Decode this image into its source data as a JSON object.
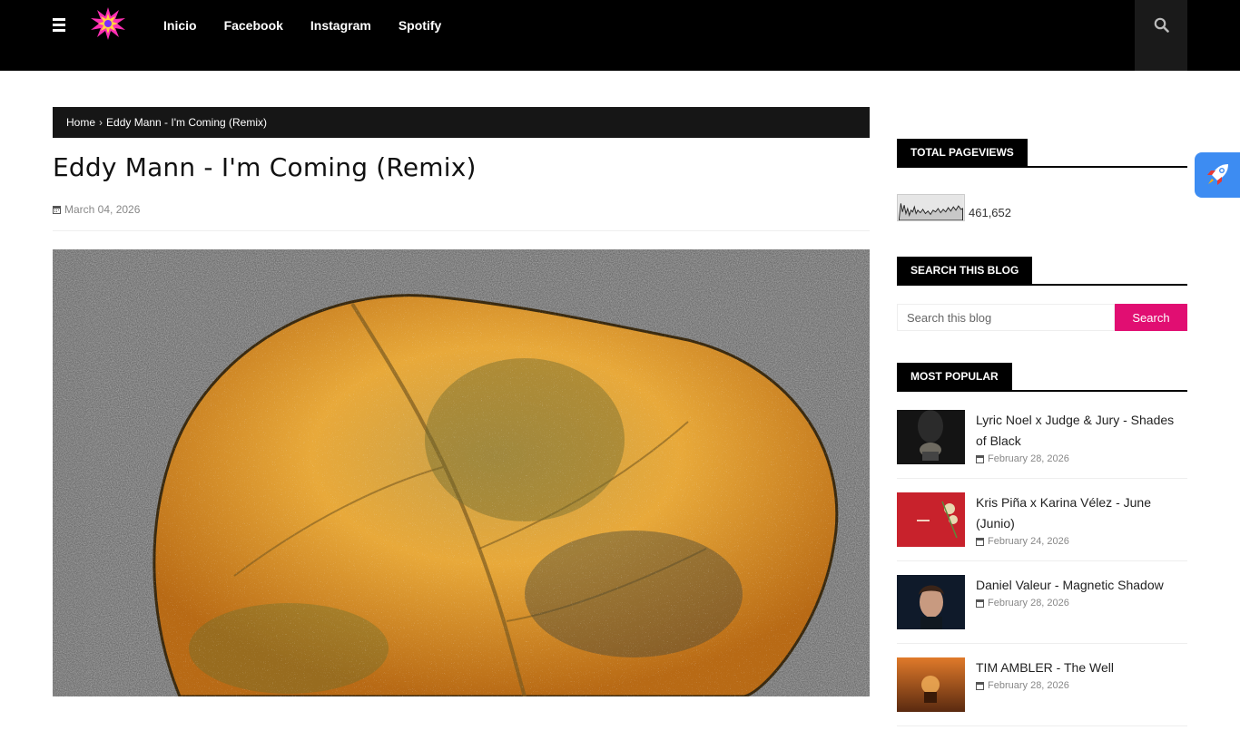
{
  "nav": {
    "items": [
      "Inicio",
      "Facebook",
      "Instagram",
      "Spotify"
    ]
  },
  "icons": {
    "menu": "hamburger-icon",
    "search": "search-icon",
    "calendar": "calendar-icon",
    "rocket": "rocket-icon"
  },
  "colors": {
    "accent": "#e10e72",
    "topbar": "#000000",
    "rocket_bg": "#3d8cf2"
  },
  "breadcrumb": {
    "home": "Home",
    "separator": "›",
    "current": "Eddy Mann - I'm Coming (Remix)"
  },
  "post": {
    "title": "Eddy Mann - I'm Coming (Remix)",
    "date": "March 04, 2026"
  },
  "sidebar": {
    "pageviews": {
      "title": "Total Pageviews",
      "count": "461,652"
    },
    "search": {
      "title": "Search This Blog",
      "placeholder": "Search this blog",
      "button": "Search"
    },
    "popular": {
      "title": "Most Popular",
      "items": [
        {
          "title": "Lyric Noel x Judge & Jury - Shades of Black",
          "date": "February 28, 2026"
        },
        {
          "title": "Kris Piña x Karina Vélez - June (Junio)",
          "date": "February 24, 2026"
        },
        {
          "title": "Daniel Valeur - Magnetic Shadow",
          "date": "February 28, 2026"
        },
        {
          "title": "TIM AMBLER - The Well",
          "date": "February 28, 2026"
        }
      ]
    }
  }
}
